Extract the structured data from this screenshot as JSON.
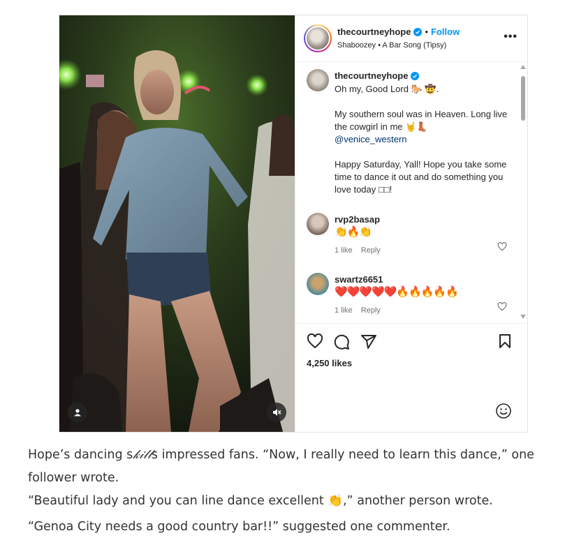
{
  "post": {
    "username": "thecourtneyhope",
    "separator": "•",
    "follow_label": "Follow",
    "audio": "Shaboozey • A Bar Song (Tipsy)",
    "more_label": "•••"
  },
  "caption": {
    "username": "thecourtneyhope",
    "line1": "Oh my, Good Lord 🐎 🤠.",
    "line2": "My southern soul was in Heaven. Long live the cowgirl in me 🤘👢",
    "mention": "@venice_western",
    "line3": "Happy Saturday, Yall! Hope you take some time to dance it out and do something you love today □□!"
  },
  "comments": [
    {
      "username": "rvp2basap",
      "text": "👏🔥👏",
      "likes": "1 like",
      "reply": "Reply"
    },
    {
      "username": "swartz6651",
      "text": "❤️❤️❤️❤️❤️🔥🔥🔥🔥🔥",
      "likes": "1 like",
      "reply": "Reply"
    }
  ],
  "likes_count": "4,250 likes",
  "article": {
    "p1_before": "Hope’s dancing s",
    "p1_stylized": "𝓀𝒾𝓁𝓁",
    "p1_after": "s impressed fans. “Now, I really need to learn this dance,” one follower wrote.",
    "p2": "“Beautiful lady and you can line dance excellent 👏,” another person wrote.",
    "p3": "“Genoa City needs a good country bar!!” suggested one commenter."
  },
  "colors": {
    "accent": "#0095f6",
    "text": "#262626",
    "muted": "#737373",
    "mention": "#00376b"
  },
  "icons": [
    "user-tag-icon",
    "mute-icon",
    "more-options-icon",
    "heart-icon",
    "comment-icon",
    "share-icon",
    "save-icon",
    "emoji-icon",
    "verified-icon"
  ]
}
